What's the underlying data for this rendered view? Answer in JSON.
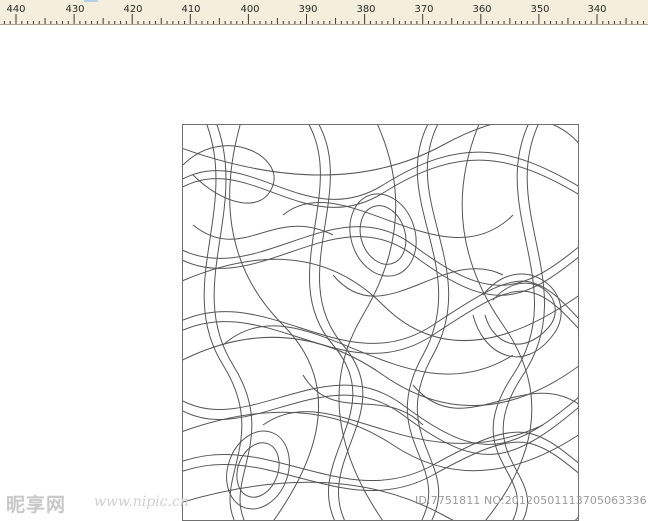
{
  "ruler": {
    "labels": [
      "440",
      "430",
      "420",
      "410",
      "400",
      "390",
      "380",
      "370",
      "360",
      "350",
      "340"
    ]
  },
  "watermark": {
    "logo": "昵享网",
    "url": "www.nipic.cn",
    "id": "ID:7751811 NO:20120501113705063336"
  }
}
